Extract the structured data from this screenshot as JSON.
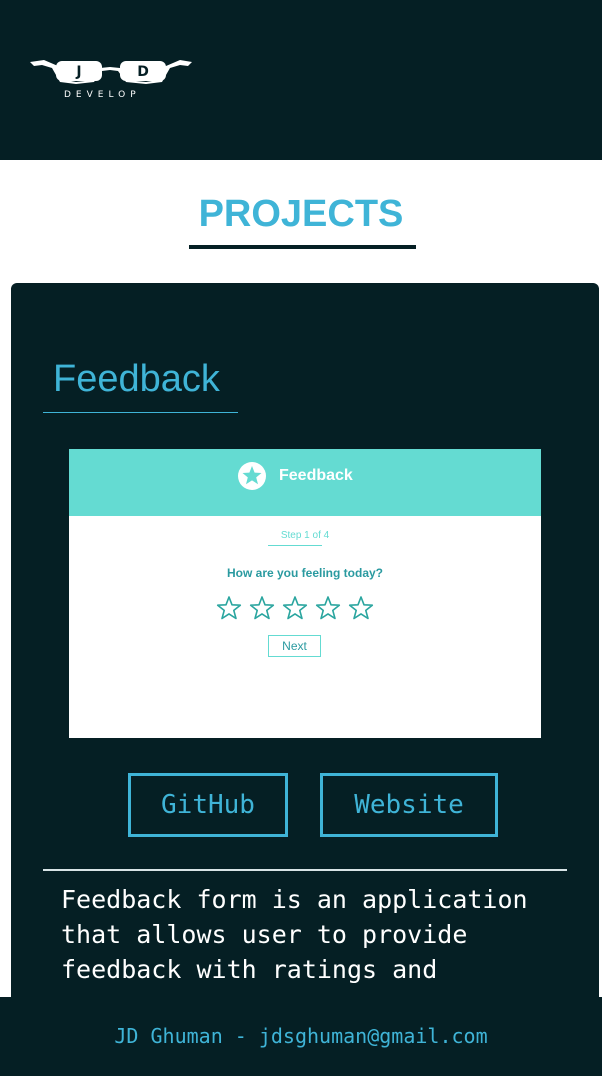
{
  "brand": {
    "initials": [
      "J",
      "D"
    ],
    "tagline": "DEVELOP",
    "logo_icon": "glasses-icon"
  },
  "section": {
    "title": "PROJECTS"
  },
  "project": {
    "name": "Feedback",
    "preview": {
      "header_icon": "star-icon",
      "header_title": "Feedback",
      "step": "Step 1 of 4",
      "question": "How are you feeling today?",
      "rating_icons": [
        "star-outline-icon",
        "star-outline-icon",
        "star-outline-icon",
        "star-outline-icon",
        "star-outline-icon"
      ],
      "next_label": "Next"
    },
    "github_label": "GitHub",
    "website_label": "Website",
    "description": "Feedback form is an application that allows user to provide feedback with ratings and"
  },
  "footer": {
    "text": "JD Ghuman - jdsghuman@gmail.com"
  },
  "colors": {
    "dark": "#051f24",
    "accent": "#3fb4d7",
    "teal": "#64dbd2"
  }
}
